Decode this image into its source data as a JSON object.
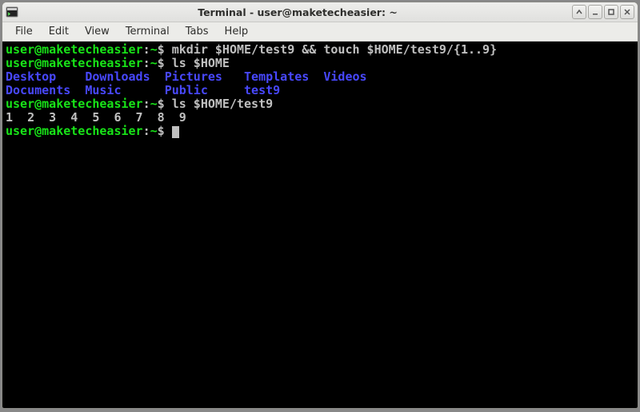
{
  "window": {
    "title": "Terminal - user@maketecheasier: ~"
  },
  "menubar": {
    "items": [
      "File",
      "Edit",
      "View",
      "Terminal",
      "Tabs",
      "Help"
    ]
  },
  "prompt": {
    "user": "user",
    "at": "@",
    "host": "maketecheasier",
    "colon": ":",
    "path": "~",
    "dollar": "$"
  },
  "commands": {
    "cmd1": "mkdir $HOME/test9 && touch $HOME/test9/{1..9}",
    "cmd2": "ls $HOME",
    "cmd3": "ls $HOME/test9"
  },
  "ls_home": {
    "row1": {
      "c1": "Desktop",
      "c2": "Downloads",
      "c3": "Pictures",
      "c4": "Templates",
      "c5": "Videos"
    },
    "row2": {
      "c1": "Documents",
      "c2": "Music",
      "c3": "Public",
      "c4": "test9"
    }
  },
  "ls_test9": "1  2  3  4  5  6  7  8  9"
}
